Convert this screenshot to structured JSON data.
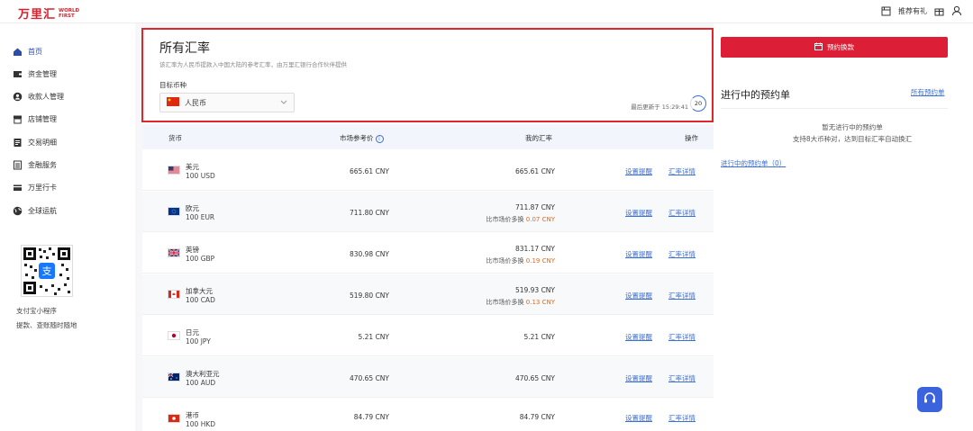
{
  "brand": {
    "name": "万里汇",
    "en_line1": "WORLD",
    "en_line2": "FIRST",
    "color": "#d4232e"
  },
  "topbar": {
    "referral_label": "推荐有礼"
  },
  "sidebar": {
    "items": [
      {
        "label": "首页",
        "icon": "home-icon"
      },
      {
        "label": "资金管理",
        "icon": "wallet-icon"
      },
      {
        "label": "收款人管理",
        "icon": "user-icon"
      },
      {
        "label": "店铺管理",
        "icon": "store-icon"
      },
      {
        "label": "交易明细",
        "icon": "list-icon"
      },
      {
        "label": "金融服务",
        "icon": "finance-icon"
      },
      {
        "label": "万里行卡",
        "icon": "card-icon"
      },
      {
        "label": "全球运航",
        "icon": "globe-icon"
      }
    ],
    "miniprogram_line1": "支付宝小程序",
    "miniprogram_line2": "提款、查账随时随地"
  },
  "rates": {
    "title": "所有汇率",
    "subtitle": "该汇率为人民币提款入中国大陆的参考汇率，由万里汇银行合作伙伴提供",
    "target_label": "目标币种",
    "target_value": "人民币",
    "updated_text": "最后更新于 15:29:41",
    "countdown": "20",
    "headers": {
      "currency": "货币",
      "market": "市场参考价",
      "mine": "我的汇率",
      "action": "操作"
    },
    "set_alert_label": "设置提醒",
    "detail_label": "汇率详情",
    "rows": [
      {
        "flag": "us",
        "name": "美元",
        "amount": "100 USD",
        "market": "665.61 CNY",
        "mine": "665.61 CNY",
        "diff_prefix": "",
        "diff_value": ""
      },
      {
        "flag": "eu",
        "name": "欧元",
        "amount": "100 EUR",
        "market": "711.80 CNY",
        "mine": "711.87 CNY",
        "diff_prefix": "比市场价多换",
        "diff_value": "0.07 CNY"
      },
      {
        "flag": "gb",
        "name": "英镑",
        "amount": "100 GBP",
        "market": "830.98 CNY",
        "mine": "831.17 CNY",
        "diff_prefix": "比市场价多换",
        "diff_value": "0.19 CNY"
      },
      {
        "flag": "ca",
        "name": "加拿大元",
        "amount": "100 CAD",
        "market": "519.80 CNY",
        "mine": "519.93 CNY",
        "diff_prefix": "比市场价多换",
        "diff_value": "0.13 CNY"
      },
      {
        "flag": "jp",
        "name": "日元",
        "amount": "100 JPY",
        "market": "5.21 CNY",
        "mine": "5.21 CNY",
        "diff_prefix": "",
        "diff_value": ""
      },
      {
        "flag": "au",
        "name": "澳大利亚元",
        "amount": "100 AUD",
        "market": "470.65 CNY",
        "mine": "470.65 CNY",
        "diff_prefix": "",
        "diff_value": ""
      },
      {
        "flag": "hk",
        "name": "港币",
        "amount": "100 HKD",
        "market": "84.79 CNY",
        "mine": "84.79 CNY",
        "diff_prefix": "",
        "diff_value": ""
      }
    ]
  },
  "right": {
    "book_label": "预约换款",
    "pending_title": "进行中的预约单",
    "all_link": "所有预约单",
    "empty_line1": "暂无进行中的预约单",
    "empty_line2": "支持8大币种对，达到目标汇率自动换汇",
    "pending_link": "进行中的预约单（0）"
  },
  "colors": {
    "accent": "#3b6fd6",
    "danger": "#dc1f36",
    "highlight_border": "#e0252b"
  }
}
